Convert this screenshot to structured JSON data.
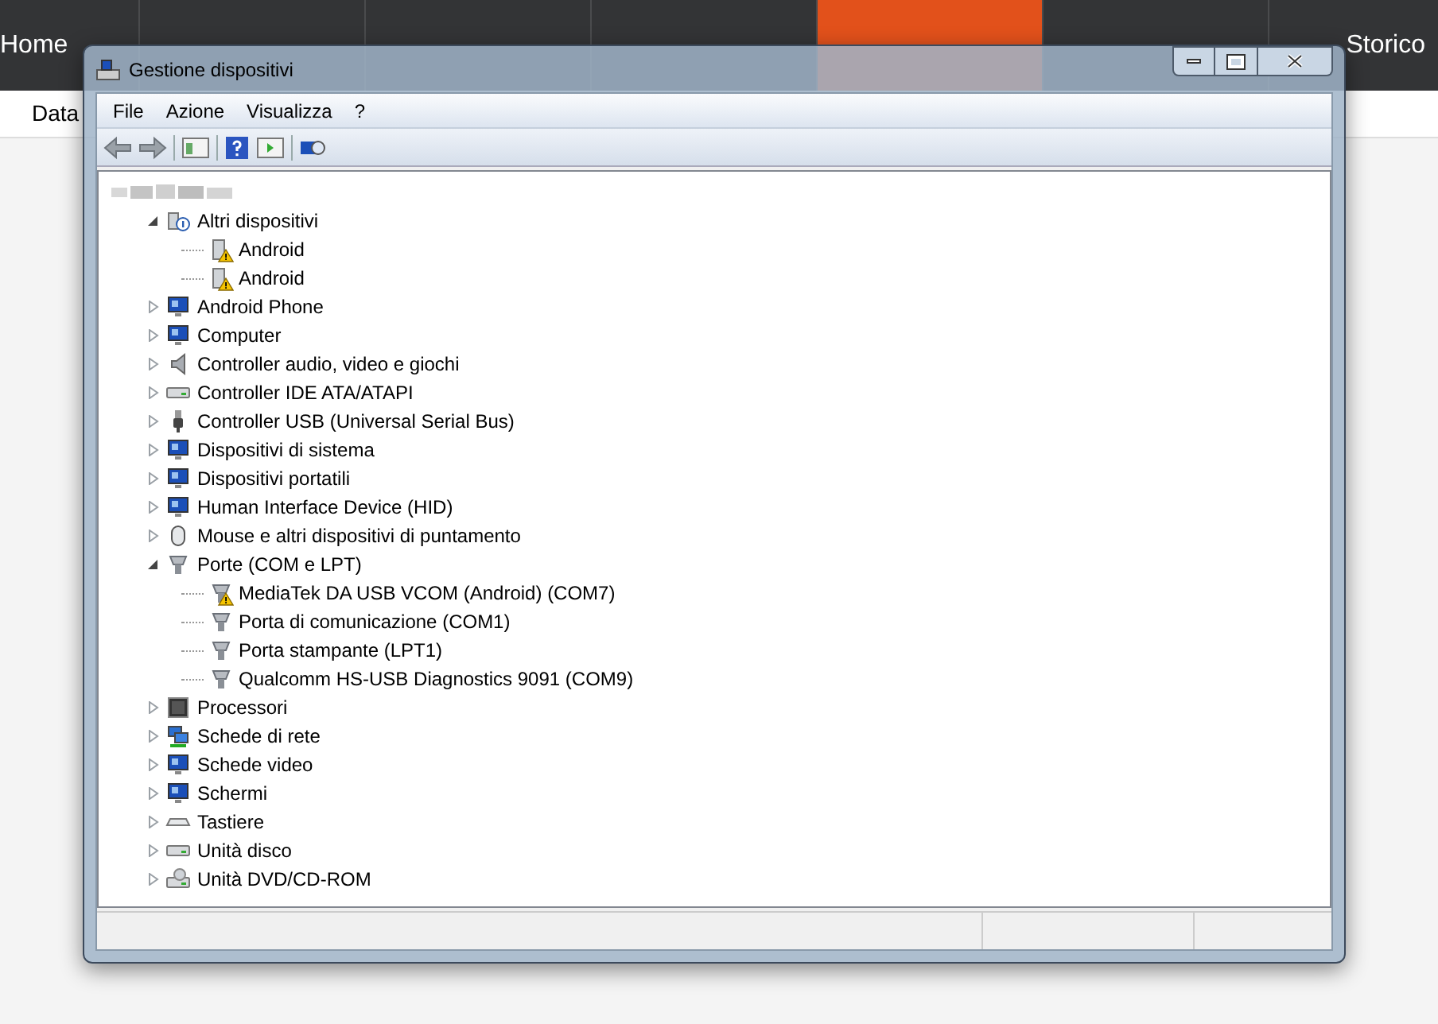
{
  "app_nav": {
    "tabs": [
      {
        "label": "Home",
        "selected": false
      },
      {
        "selected": false
      },
      {
        "selected": false
      },
      {
        "selected": false
      },
      {
        "selected": true
      },
      {
        "selected": false
      },
      {
        "label": "Storico",
        "selected": false
      }
    ]
  },
  "app_subbar": {
    "label": "Data"
  },
  "window": {
    "title": "Gestione dispositivi"
  },
  "menu": [
    "File",
    "Azione",
    "Visualizza",
    "?"
  ],
  "tree": {
    "children": [
      {
        "label": "Altri dispositivi",
        "expanded": true,
        "children": [
          {
            "label": "Android",
            "warning": true
          },
          {
            "label": "Android",
            "warning": true
          }
        ]
      },
      {
        "label": "Android Phone",
        "expanded": false
      },
      {
        "label": "Computer",
        "expanded": false
      },
      {
        "label": "Controller audio, video e giochi",
        "expanded": false
      },
      {
        "label": "Controller IDE ATA/ATAPI",
        "expanded": false
      },
      {
        "label": "Controller USB (Universal Serial Bus)",
        "expanded": false
      },
      {
        "label": "Dispositivi di sistema",
        "expanded": false
      },
      {
        "label": "Dispositivi portatili",
        "expanded": false
      },
      {
        "label": "Human Interface Device (HID)",
        "expanded": false
      },
      {
        "label": "Mouse e altri dispositivi di puntamento",
        "expanded": false
      },
      {
        "label": "Porte (COM e LPT)",
        "expanded": true,
        "children": [
          {
            "label": "MediaTek DA USB VCOM (Android) (COM7)",
            "warning": true
          },
          {
            "label": "Porta di comunicazione (COM1)",
            "warning": false
          },
          {
            "label": "Porta stampante (LPT1)",
            "warning": false
          },
          {
            "label": "Qualcomm HS-USB Diagnostics 9091 (COM9)",
            "warning": false
          }
        ]
      },
      {
        "label": "Processori",
        "expanded": false
      },
      {
        "label": "Schede di rete",
        "expanded": false
      },
      {
        "label": "Schede video",
        "expanded": false
      },
      {
        "label": "Schermi",
        "expanded": false
      },
      {
        "label": "Tastiere",
        "expanded": false
      },
      {
        "label": "Unità disco",
        "expanded": false
      },
      {
        "label": "Unità DVD/CD-ROM",
        "expanded": false
      }
    ]
  }
}
